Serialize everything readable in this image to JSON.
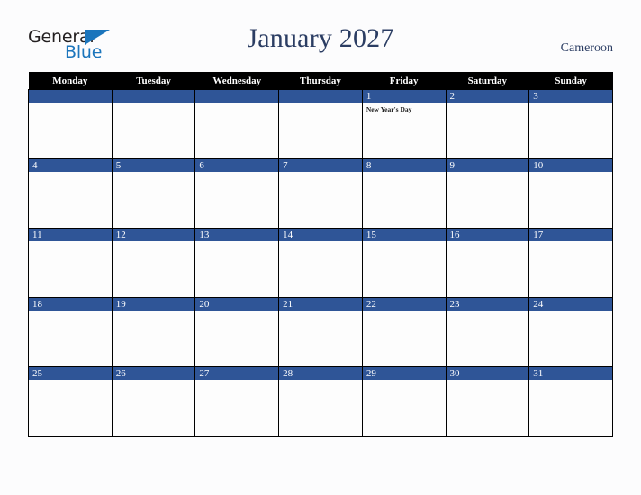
{
  "header": {
    "logo": {
      "text_primary": "General",
      "text_secondary": "Blue",
      "triangle_color": "#1b75bc",
      "primary_color": "#231f20"
    },
    "title": "January 2027",
    "country": "Cameroon"
  },
  "colors": {
    "weekday_header_bg": "#000000",
    "weekday_header_text": "#ffffff",
    "daynum_band": "#2f5597",
    "daynum_text": "#ffffff",
    "title_text": "#2b3d63",
    "cell_border": "#000000",
    "page_bg": "#fcfcfd",
    "cell_bg": "#fdfdfd",
    "event_text": "#1a1a1a"
  },
  "weekdays": [
    "Monday",
    "Tuesday",
    "Wednesday",
    "Thursday",
    "Friday",
    "Saturday",
    "Sunday"
  ],
  "weeks": [
    [
      {
        "day": "",
        "events": []
      },
      {
        "day": "",
        "events": []
      },
      {
        "day": "",
        "events": []
      },
      {
        "day": "",
        "events": []
      },
      {
        "day": "1",
        "events": [
          "New Year's Day"
        ]
      },
      {
        "day": "2",
        "events": []
      },
      {
        "day": "3",
        "events": []
      }
    ],
    [
      {
        "day": "4",
        "events": []
      },
      {
        "day": "5",
        "events": []
      },
      {
        "day": "6",
        "events": []
      },
      {
        "day": "7",
        "events": []
      },
      {
        "day": "8",
        "events": []
      },
      {
        "day": "9",
        "events": []
      },
      {
        "day": "10",
        "events": []
      }
    ],
    [
      {
        "day": "11",
        "events": []
      },
      {
        "day": "12",
        "events": []
      },
      {
        "day": "13",
        "events": []
      },
      {
        "day": "14",
        "events": []
      },
      {
        "day": "15",
        "events": []
      },
      {
        "day": "16",
        "events": []
      },
      {
        "day": "17",
        "events": []
      }
    ],
    [
      {
        "day": "18",
        "events": []
      },
      {
        "day": "19",
        "events": []
      },
      {
        "day": "20",
        "events": []
      },
      {
        "day": "21",
        "events": []
      },
      {
        "day": "22",
        "events": []
      },
      {
        "day": "23",
        "events": []
      },
      {
        "day": "24",
        "events": []
      }
    ],
    [
      {
        "day": "25",
        "events": []
      },
      {
        "day": "26",
        "events": []
      },
      {
        "day": "27",
        "events": []
      },
      {
        "day": "28",
        "events": []
      },
      {
        "day": "29",
        "events": []
      },
      {
        "day": "30",
        "events": []
      },
      {
        "day": "31",
        "events": []
      }
    ]
  ]
}
